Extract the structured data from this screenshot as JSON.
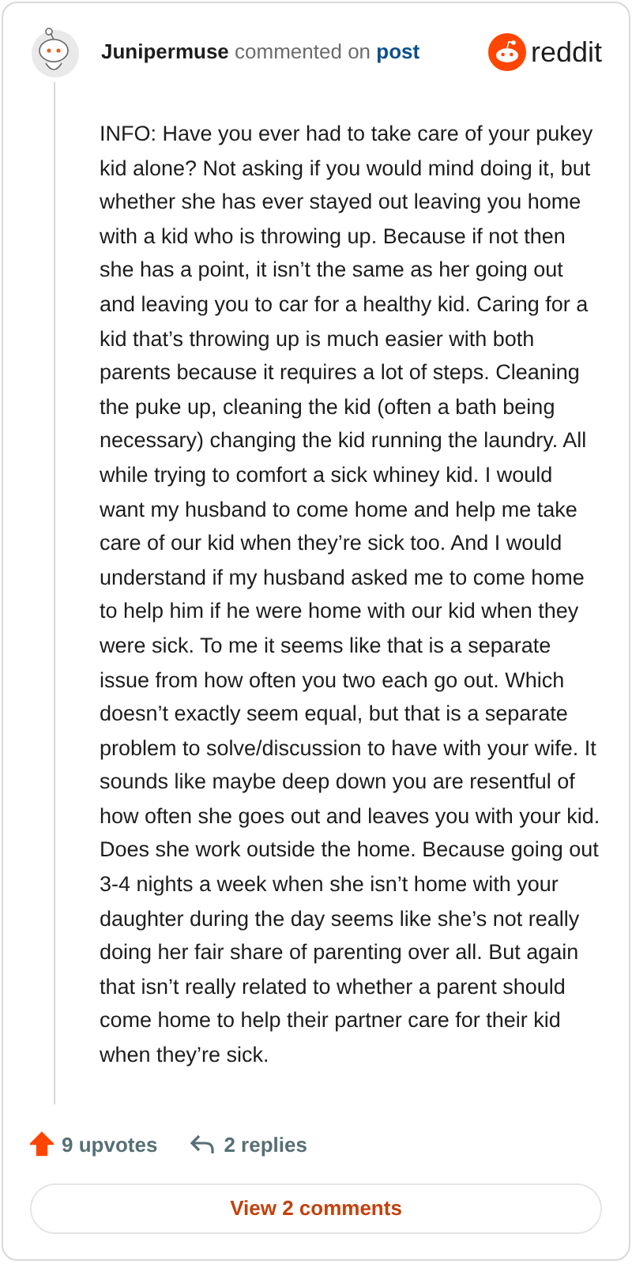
{
  "header": {
    "author": "Junipermuse",
    "action": "commented on",
    "link": "post",
    "brand": "reddit"
  },
  "body": "INFO: Have you ever had to take care of your pukey kid alone? Not asking if you would mind doing it, but whether she has ever stayed out leaving you home with a kid who is throwing up. Because if not then she has a point, it isn’t the same as her going out and leaving you to car for a healthy kid. Caring for a kid that’s throwing up is much easier with both parents because it requires a lot of steps. Cleaning the puke up, cleaning the kid (often a bath being necessary) changing the kid running the laundry. All while trying to comfort a sick whiney kid. I would want my husband to come home and help me take care of our kid when they’re sick too. And I would understand if my husband asked me to come home to help him if he were home with our kid when they were sick. To me it seems like that is a separate issue from how often you two each go out. Which doesn’t exactly seem equal, but that is a separate problem to solve/discussion to have with your wife. It sounds like maybe deep down you are resentful of how often she goes out and leaves you with your kid. Does she work outside the home. Because going out 3-4 nights a week when she isn’t home with your daughter during the day seems like she’s not really doing her fair share of parenting over all. But again that isn’t really related to whether a parent should come home to help their partner care for their kid when they’re sick.",
  "footer": {
    "upvotes": "9 upvotes",
    "upvoted": true,
    "replies": "2 replies",
    "button": "View 2 comments"
  }
}
